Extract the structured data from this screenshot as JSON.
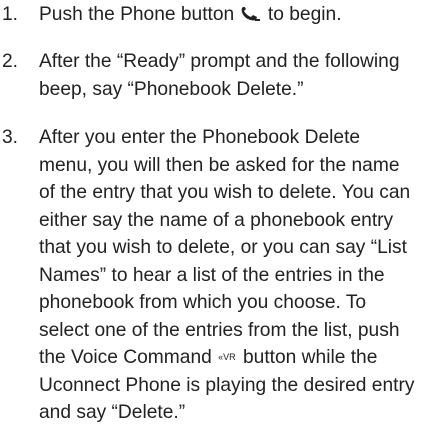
{
  "steps": [
    {
      "number": "1.",
      "lines": [
        "Push the Phone button",
        "to begin."
      ],
      "icon": "phone-icon"
    },
    {
      "number": "2.",
      "lines": [
        "After the “Ready” prompt and the following",
        "beep, say “Phonebook Delete.”"
      ]
    },
    {
      "number": "3.",
      "lines": [
        "After you enter the Phonebook Delete",
        "menu, you will then be asked for the name",
        "of the entry that you wish to delete. You can",
        "either say the name of a phonebook entry",
        "that you wish to delete, or you can say “List",
        "Names” to hear a list of the entries in the",
        "phonebook from which you choose. To",
        "select one of the entries from the list, push",
        "the Voice Command",
        "button while the",
        "Uconnect Phone is playing the desired entry",
        "and say “Delete.”"
      ],
      "icon": "voice-command-icon",
      "icon_text": "«VR"
    }
  ]
}
